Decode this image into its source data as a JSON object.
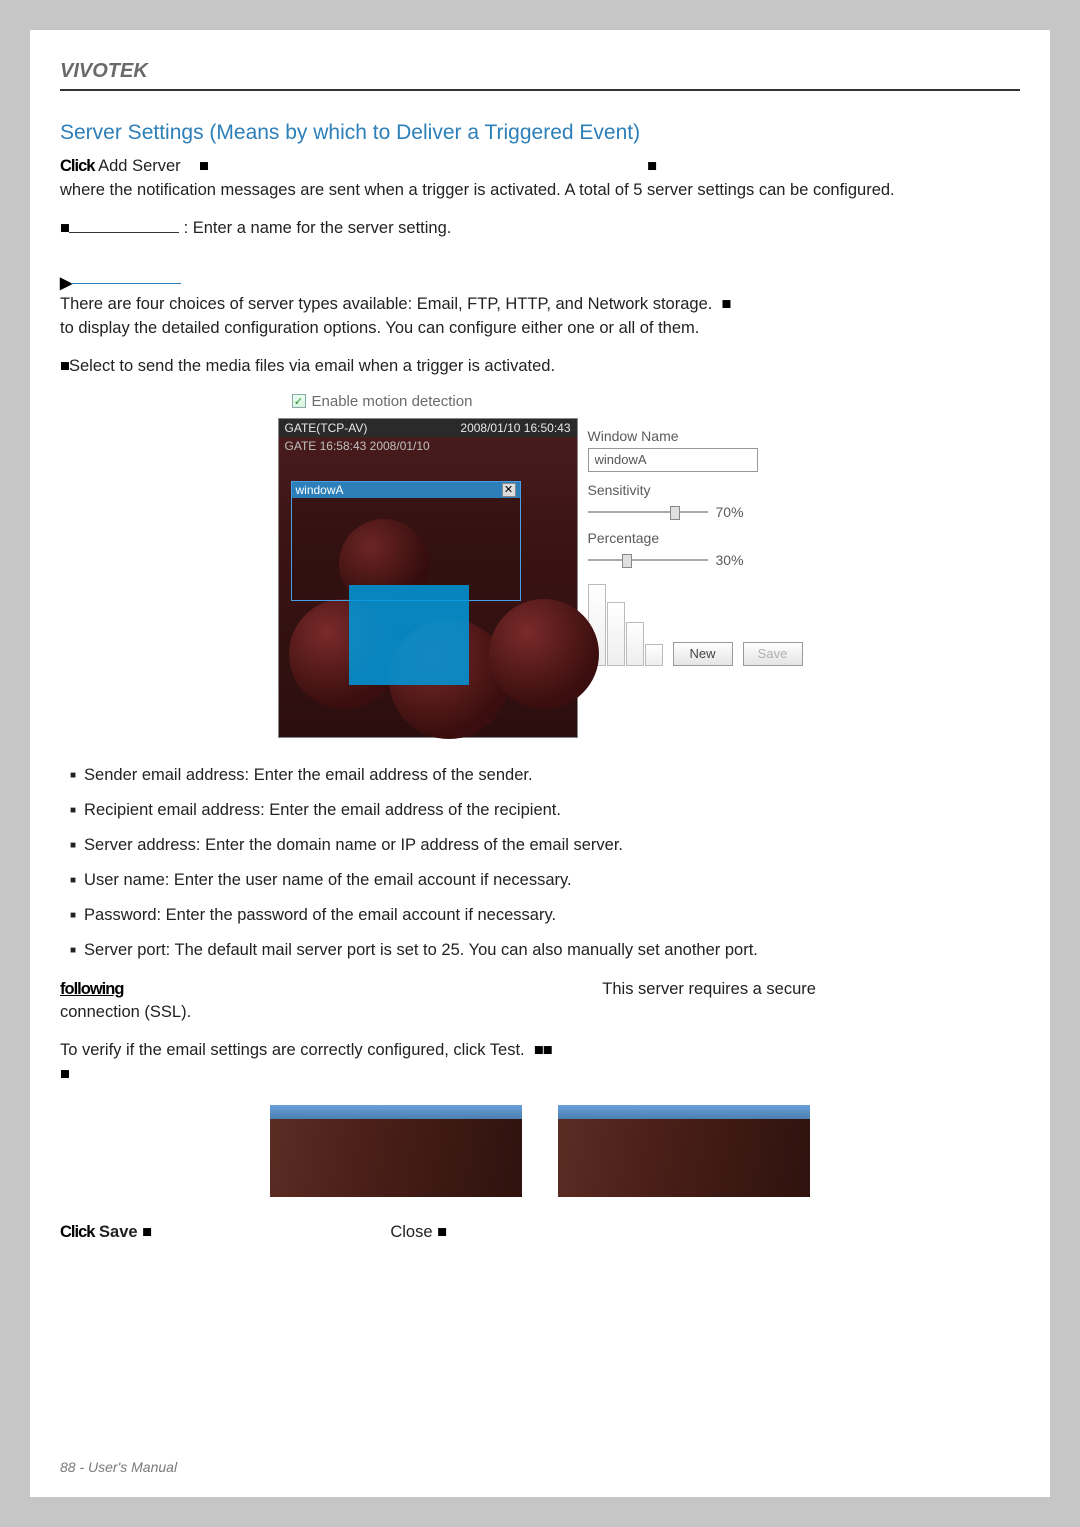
{
  "brand": "VIVOTEK",
  "section_title": "Server Settings (Means by which to Deliver a Triggered Event)",
  "intro": {
    "click_prefix": "Click",
    "add_server": "Add Server",
    "line_rest": "where the notification messages are sent when a trigger is activated. A total of 5 server settings can be configured."
  },
  "server_name_hint": ": Enter a name for the server setting.",
  "server_type": {
    "para1": "There are four choices of server types available: Email, FTP, HTTP, and Network storage.",
    "para2": "to display the detailed configuration options. You can configure either one or all of them."
  },
  "email_select": "Select to send the media files via email when a trigger is activated.",
  "motion_panel": {
    "enable_label": "Enable motion detection",
    "cam_title_left": "GATE(TCP-AV)",
    "cam_title_right": "2008/01/10 16:50:43",
    "cam_sub": "GATE 16:58:43 2008/01/10",
    "md_window_name": "windowA",
    "label_window_name": "Window Name",
    "input_window_name": "windowA",
    "label_sensitivity": "Sensitivity",
    "sensitivity_value": "70%",
    "label_percentage": "Percentage",
    "percentage_value": "30%",
    "btn_new": "New",
    "btn_save": "Save"
  },
  "email_fields": [
    "Sender email address: Enter the email address of the sender.",
    "Recipient email address: Enter the email address of the recipient.",
    "Server address: Enter the domain name or IP address of the email server.",
    "User name: Enter the user name of the email account if necessary.",
    "Password: Enter the password of the email account if necessary.",
    "Server port: The default mail server port is set to 25. You can also manually set another port."
  ],
  "ssl": {
    "tail": "This server requires a secure",
    "line2": "connection (SSL)."
  },
  "verify": {
    "line1": "To verify if the email settings are correctly configured, click Test."
  },
  "bottom": {
    "click_prefix": "Click",
    "save": "Save",
    "close": "Close"
  },
  "footer": "88 - User's Manual"
}
